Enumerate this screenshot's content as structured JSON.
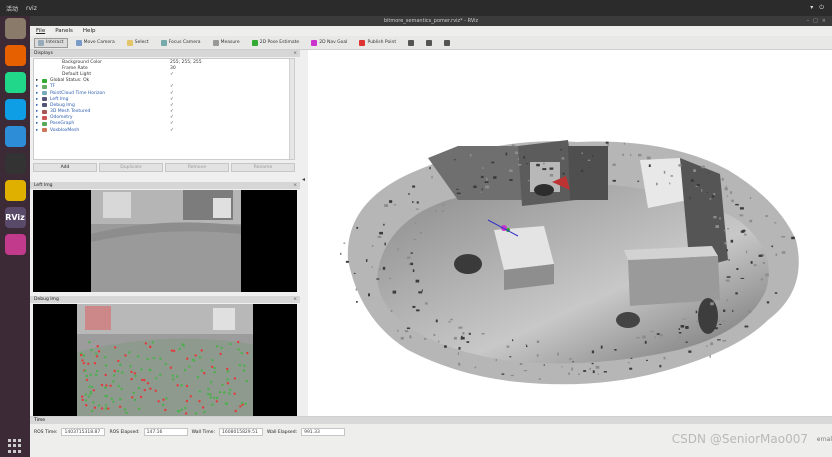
{
  "topbar": {
    "activities": "活动",
    "app": "rviz",
    "clock": "",
    "tray": [
      "▾",
      "⏻"
    ]
  },
  "dock": {
    "items": [
      {
        "icon": "files-icon",
        "color": "#8a7a6a"
      },
      {
        "icon": "firefox-icon",
        "color": "#e66000"
      },
      {
        "icon": "pycharm-icon",
        "color": "#21d789"
      },
      {
        "icon": "clion-icon",
        "color": "#0d9ee6"
      },
      {
        "icon": "vscode-icon",
        "color": "#2d8dd6"
      },
      {
        "icon": "terminal-icon",
        "color": "#333333"
      },
      {
        "icon": "chrome-icon",
        "color": "#e0b000"
      },
      {
        "icon": "rviz-icon",
        "color": "#5a4a6a",
        "label": "RViz"
      },
      {
        "icon": "gems-icon",
        "color": "#c23a8c"
      }
    ]
  },
  "window": {
    "title": "bitmore_semantics_pomer.rviz* - RViz",
    "menu": [
      "File",
      "Panels",
      "Help"
    ],
    "toolbar": [
      {
        "label": "Interact",
        "icon": "interact-icon",
        "color": "#9ab",
        "active": true
      },
      {
        "label": "Move Camera",
        "icon": "move-camera-icon",
        "color": "#7a9ac8"
      },
      {
        "label": "Select",
        "icon": "select-icon",
        "color": "#e5c56a"
      },
      {
        "label": "Focus Camera",
        "icon": "focus-camera-icon",
        "color": "#7aa"
      },
      {
        "label": "Measure",
        "icon": "measure-icon",
        "color": "#999"
      },
      {
        "label": "2D Pose Estimate",
        "icon": "pose-estimate-icon",
        "color": "#3a3"
      },
      {
        "label": "2D Nav Goal",
        "icon": "nav-goal-icon",
        "color": "#c3c"
      },
      {
        "label": "Publish Point",
        "icon": "publish-point-icon",
        "color": "#d33"
      },
      {
        "label": "",
        "icon": "plus-icon",
        "color": "#555"
      },
      {
        "label": "",
        "icon": "minus-icon",
        "color": "#555"
      },
      {
        "label": "",
        "icon": "camera-icon",
        "color": "#555"
      }
    ]
  },
  "displays": {
    "title": "Displays",
    "rows": [
      {
        "label": "Background Color",
        "value": "255; 255; 255",
        "indent": 20,
        "kind": "prop"
      },
      {
        "label": "Frame Rate",
        "value": "30",
        "indent": 20,
        "kind": "prop"
      },
      {
        "label": "Default Light",
        "value": "✓",
        "indent": 20,
        "kind": "prop"
      },
      {
        "label": "Global Status: Ok",
        "value": "",
        "indent": 8,
        "kind": "status",
        "icon": "#3a3"
      },
      {
        "label": "TF",
        "value": "✓",
        "indent": 8,
        "kind": "plugin",
        "icon": "#6a6"
      },
      {
        "label": "PointCloud Time Horizon",
        "value": "✓",
        "indent": 8,
        "kind": "plugin",
        "icon": "#7ab"
      },
      {
        "label": "Left Img",
        "value": "✓",
        "indent": 8,
        "kind": "plugin",
        "icon": "#557"
      },
      {
        "label": "Debug Img",
        "value": "✓",
        "indent": 8,
        "kind": "plugin",
        "icon": "#557"
      },
      {
        "label": "3D Mesh Textured",
        "value": "✓",
        "indent": 8,
        "kind": "plugin",
        "icon": "#a55"
      },
      {
        "label": "Odometry",
        "value": "✓",
        "indent": 8,
        "kind": "plugin",
        "icon": "#c55"
      },
      {
        "label": "PoseGraph",
        "value": "✓",
        "indent": 8,
        "kind": "plugin",
        "icon": "#5a5"
      },
      {
        "label": "VoxbloxMesh",
        "value": "✓",
        "indent": 8,
        "kind": "plugin",
        "icon": "#c75"
      }
    ],
    "buttons": [
      "Add",
      "Duplicate",
      "Remove",
      "Rename"
    ]
  },
  "left_img": {
    "title": "Left Img"
  },
  "debug_img": {
    "title": "Debug Img"
  },
  "time": {
    "title": "Time",
    "ros_time_label": "ROS Time:",
    "ros_time": "1403715318.87",
    "ros_elapsed_label": "ROS Elapsed:",
    "ros_elapsed": "147.16",
    "wall_time_label": "Wall Time:",
    "wall_time": "1608015829.51",
    "wall_elapsed_label": "Wall Elapsed:",
    "wall_elapsed": "991.33"
  },
  "watermark": {
    "text": "CSDN @SeniorMao007",
    "edge": "ernal"
  }
}
